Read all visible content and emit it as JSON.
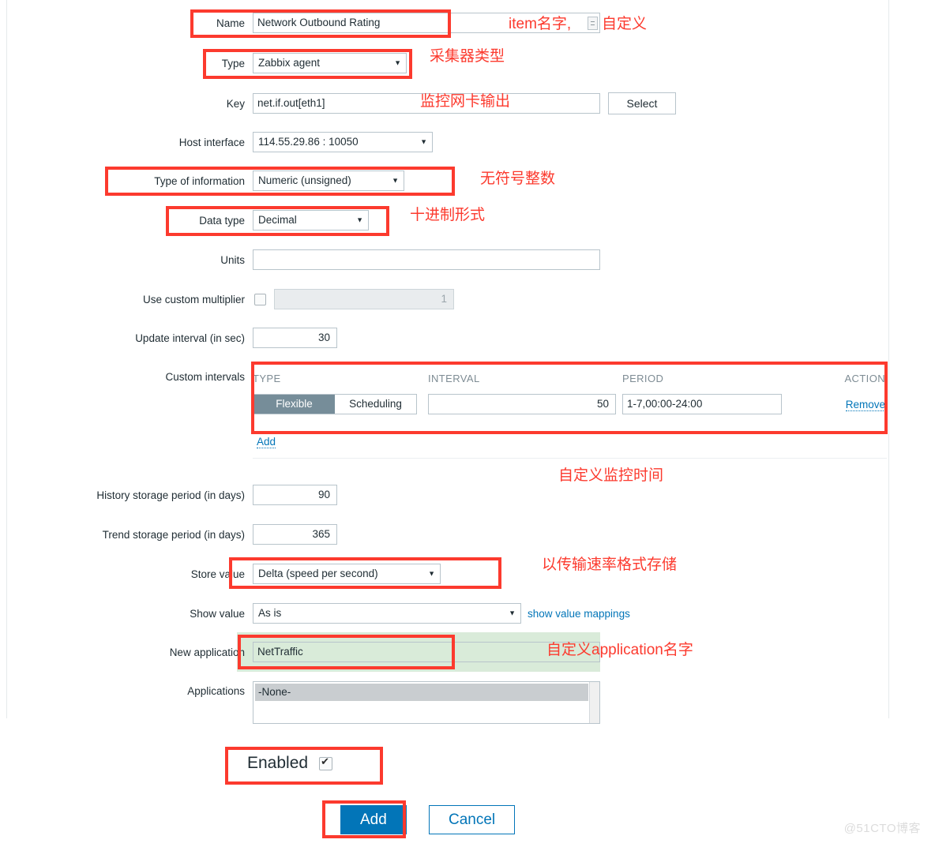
{
  "form": {
    "fields": {
      "name": {
        "label": "Name",
        "value": "Network Outbound Rating"
      },
      "type": {
        "label": "Type",
        "value": "Zabbix agent"
      },
      "key": {
        "label": "Key",
        "value": "net.if.out[eth1]",
        "select_button": "Select"
      },
      "host_interface": {
        "label": "Host interface",
        "value": "114.55.29.86 : 10050"
      },
      "type_of_information": {
        "label": "Type of information",
        "value": "Numeric (unsigned)"
      },
      "data_type": {
        "label": "Data type",
        "value": "Decimal"
      },
      "units": {
        "label": "Units",
        "value": ""
      },
      "use_custom_multiplier": {
        "label": "Use custom multiplier",
        "checked": false,
        "value": "1"
      },
      "update_interval": {
        "label": "Update interval (in sec)",
        "value": "30"
      },
      "custom_intervals": {
        "label": "Custom intervals"
      },
      "history_storage_period": {
        "label": "History storage period (in days)",
        "value": "90"
      },
      "trend_storage_period": {
        "label": "Trend storage period (in days)",
        "value": "365"
      },
      "store_value": {
        "label": "Store value",
        "value": "Delta (speed per second)"
      },
      "show_value": {
        "label": "Show value",
        "value": "As is",
        "mappings_link": "show value mappings"
      },
      "new_application": {
        "label": "New application",
        "value": "NetTraffic"
      },
      "applications": {
        "label": "Applications",
        "options": [
          "-None-"
        ],
        "selected": "-None-"
      },
      "enabled": {
        "label": "Enabled",
        "checked": true
      }
    },
    "custom_intervals_table": {
      "headers": [
        "TYPE",
        "INTERVAL",
        "PERIOD",
        "ACTION"
      ],
      "rows": [
        {
          "type_flexible": "Flexible",
          "type_scheduling": "Scheduling",
          "type_selected": "Flexible",
          "interval": "50",
          "period": "1-7,00:00-24:00",
          "action": "Remove"
        }
      ],
      "add_link": "Add"
    },
    "buttons": {
      "add": "Add",
      "cancel": "Cancel"
    }
  },
  "annotations": [
    {
      "id": "name-note",
      "text": "item名字,"
    },
    {
      "id": "name-note2",
      "text": "自定义"
    },
    {
      "id": "type-note",
      "text": "采集器类型"
    },
    {
      "id": "key-note",
      "text": "监控网卡输出"
    },
    {
      "id": "info-note",
      "text": "无符号整数"
    },
    {
      "id": "datatype-note",
      "text": "十进制形式"
    },
    {
      "id": "intervals-note",
      "text": "自定义监控时间"
    },
    {
      "id": "store-note",
      "text": "以传输速率格式存储"
    },
    {
      "id": "app-note",
      "text": "自定义application名字"
    }
  ],
  "watermark": {
    "text": "@51CTO博客"
  },
  "colors": {
    "annotation": "#fc3a2e",
    "primary": "#0275b8",
    "toggle_active": "#768d99",
    "highlight": "#d9ebd9"
  }
}
